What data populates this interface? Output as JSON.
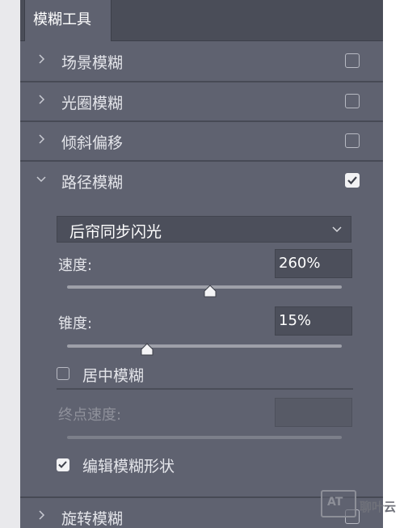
{
  "panel": {
    "tab_label": "模糊工具"
  },
  "sections": [
    {
      "label": "场景模糊",
      "expanded": false,
      "checked": false
    },
    {
      "label": "光圈模糊",
      "expanded": false,
      "checked": false
    },
    {
      "label": "倾斜偏移",
      "expanded": false,
      "checked": false
    },
    {
      "label": "路径模糊",
      "expanded": true,
      "checked": true
    },
    {
      "label": "旋转模糊",
      "expanded": false,
      "checked": false
    }
  ],
  "path_blur": {
    "preset_value": "后帘同步闪光",
    "speed": {
      "label": "速度:",
      "value": "260%",
      "slider_fraction": 0.52
    },
    "taper": {
      "label": "锥度:",
      "value": "15%",
      "slider_fraction": 0.29
    },
    "center_blur": {
      "label": "居中模糊",
      "checked": false
    },
    "end_speed": {
      "label": "终点速度:",
      "value": "",
      "enabled": false
    },
    "edit_shapes": {
      "label": "编辑模糊形状",
      "checked": true
    }
  },
  "watermark": {
    "logo_text": "AT",
    "text": "聊叶云"
  },
  "icons": {
    "collapsed": "chevron-right-icon",
    "expanded": "chevron-down-icon",
    "select_arrow": "chevron-down-icon",
    "check": "checkmark-icon",
    "slider": "slider-thumb-icon"
  },
  "colors": {
    "panel_bg": "#5f6270",
    "tabbar_bg": "#4a4d58",
    "field_bg": "#4c4f5b",
    "text": "#e4e5ea",
    "disabled_text": "#8f919b"
  }
}
